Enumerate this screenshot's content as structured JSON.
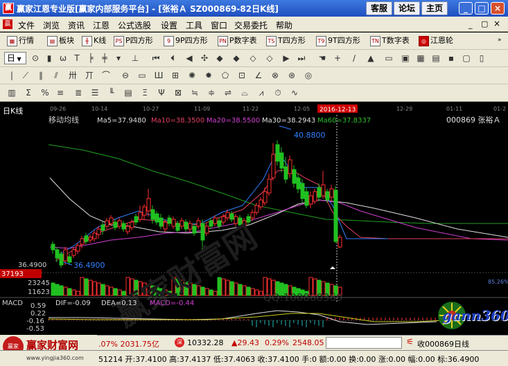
{
  "titlebar": {
    "title": "赢家江恩专业版[赢家内部服务平台] - [张裕Ａ   SZ000869-82日K线]",
    "buttons": [
      "客服",
      "论坛",
      "主页"
    ]
  },
  "menubar": {
    "items": [
      "文件",
      "浏览",
      "资讯",
      "江恩",
      "公式选股",
      "设置",
      "工具",
      "窗口",
      "交易委托",
      "帮助"
    ]
  },
  "toolbar1": {
    "items": [
      "行情",
      "板块",
      "K线",
      "P四方形",
      "9P四方形",
      "P数字表",
      "T四方形",
      "9T四方形",
      "T数字表",
      "江恩轮"
    ]
  },
  "toolbar2": {
    "period": "日"
  },
  "chart": {
    "period_label": "日K线",
    "dates": [
      "09-26",
      "10-14",
      "10-27",
      "11-09",
      "11-22",
      "12-05",
      "2016-12-13",
      "12-29",
      "01-11",
      "01-2"
    ],
    "indicator_title": "移动均线",
    "ma5": "Ma5=37.9480",
    "ma10": "Ma10=38.3500",
    "ma20": "Ma20=38.5500",
    "ma30": "Ma30=38.2943",
    "ma60": "Ma60=37.8337",
    "stock_label": "000869 张裕Ａ",
    "high_label": "40.8800",
    "low_label": "36.4900",
    "axis_price": "36.4900",
    "vol_value": "37193",
    "vol_ticks": [
      "23245",
      "11623"
    ],
    "vol_pct": "85.26%",
    "watermark": "QQ:100860360",
    "macd_label": "MACD",
    "dif": "DIF=-0.09",
    "dea": "DEA=0.13",
    "macd": "MACD=-0.44",
    "macd_ticks": [
      "0.59",
      "0.22",
      "-0.16",
      "-0.53"
    ],
    "gann_logo": "gann360"
  },
  "status1": {
    "logo": "赢家财富网",
    "idx1": ".07% 2031.75亿",
    "idx2_val": "10332.28",
    "idx2_chg": "▲29.43",
    "idx2_pct": "0.29%",
    "idx2_amt": "2548.05",
    "ticker": "收000869日线"
  },
  "status2": {
    "url": "www.yingjia360.com",
    "quote": "51214 开:37.4100 高:37.4137 低:37.4063 收:37.4100 手:0 额:0.00 换:0.00 涨:0.00 幅:0.00 标:36.4900"
  }
}
